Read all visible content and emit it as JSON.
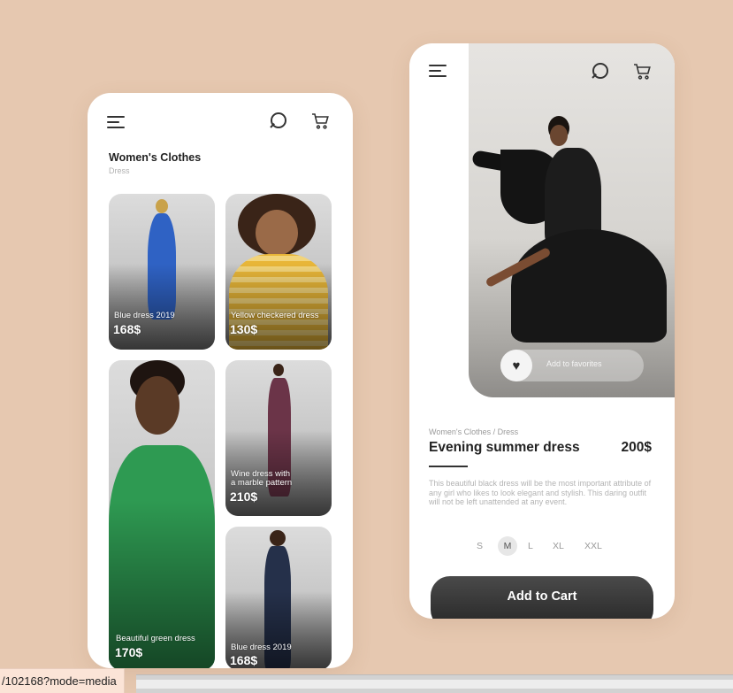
{
  "left_screen": {
    "title": "Women's Clothes",
    "subtitle": "Dress",
    "products": [
      {
        "name": "Blue dress 2019",
        "price": "168$"
      },
      {
        "name": "Yellow checkered dress",
        "price": "130$"
      },
      {
        "name": "Beautiful green dress",
        "price": "170$"
      },
      {
        "name": "Wine dress with\na marble pattern",
        "price": "210$"
      },
      {
        "name": "Blue dress 2019",
        "price": "168$"
      }
    ]
  },
  "right_screen": {
    "favorites_label": "Add to favorites",
    "breadcrumb": "Women's Clothes / Dress",
    "product_title": "Evening summer dress",
    "product_price": "200$",
    "description": "This beautiful black dress will be the most important attribute of any girl who likes to look elegant and stylish. This daring outfit will not be left unattended at any event.",
    "sizes": [
      "S",
      "M",
      "L",
      "XL",
      "XXL"
    ],
    "selected_size": "M",
    "add_to_cart_label": "Add to Cart"
  },
  "browser": {
    "url_fragment": "/102168?mode=media"
  },
  "colors": {
    "background": "#e6c8b0",
    "button_dark": "#2b2b2b"
  }
}
